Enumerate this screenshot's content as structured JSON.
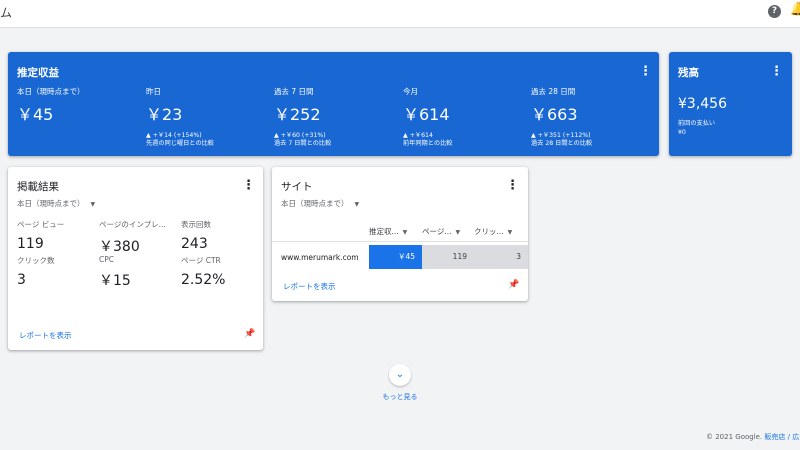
{
  "header": {
    "title": "ム",
    "help_icon": "help-icon",
    "bell_icon": "notifications-icon"
  },
  "earnings": {
    "title": "推定収益",
    "metrics": [
      {
        "label": "本日（現時点まで）",
        "value": "￥45",
        "change": "",
        "note": ""
      },
      {
        "label": "昨日",
        "value": "￥23",
        "change": "▲ +￥14 (+154%)",
        "note": "先週の同じ曜日との比較"
      },
      {
        "label": "過去 7 日間",
        "value": "￥252",
        "change": "▲ +￥60 (+31%)",
        "note": "過去 7 日間との比較"
      },
      {
        "label": "今月",
        "value": "￥614",
        "change": "▲ +￥614",
        "note": "前年同期との比較"
      },
      {
        "label": "過去 28 日間",
        "value": "￥663",
        "change": "▲ +￥351 (+112%)",
        "note": "過去 28 日間との比較"
      }
    ]
  },
  "balance": {
    "title": "残高",
    "value": "¥3,456",
    "sub_label": "前回の支払い",
    "sub_value": "¥0"
  },
  "performance": {
    "title": "掲載結果",
    "range": "本日（現時点まで）",
    "metrics": [
      {
        "label": "ページ ビュー",
        "value": "119"
      },
      {
        "label": "ページのインプレ...",
        "value": "￥380"
      },
      {
        "label": "表示回数",
        "value": "243"
      },
      {
        "label": "クリック数",
        "value": "3"
      },
      {
        "label": "CPC",
        "value": "￥15"
      },
      {
        "label": "ページ CTR",
        "value": "2.52%"
      }
    ],
    "report_link": "レポートを表示"
  },
  "sites": {
    "title": "サイト",
    "range": "本日（現時点まで）",
    "columns": [
      "推定収...",
      "ページ...",
      "クリッ..."
    ],
    "rows": [
      {
        "site": "www.merumark.com",
        "cells": [
          "￥45",
          "119",
          "3"
        ]
      }
    ],
    "report_link": "レポートを表示"
  },
  "more": {
    "label": "もっと見る"
  },
  "footer": {
    "text": "© 2021 Google. ",
    "link": "販売店 / 広告"
  },
  "colors": {
    "primary_blue": "#1967d2",
    "link_blue": "#1a73e8",
    "background": "#f1f3f4"
  }
}
